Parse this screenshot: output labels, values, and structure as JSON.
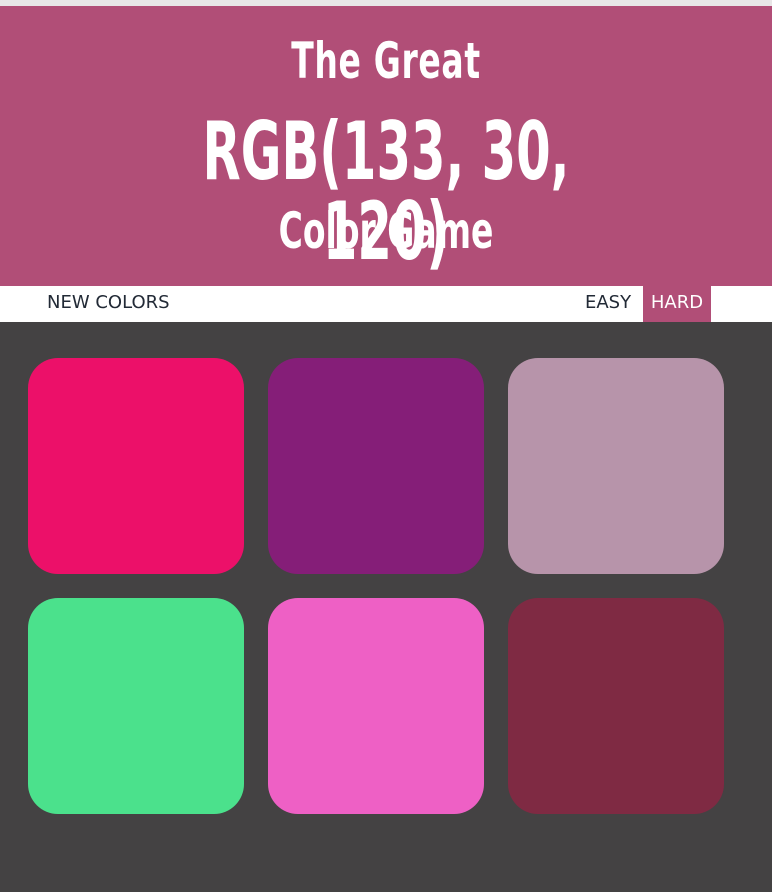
{
  "header": {
    "title_top": "The Great",
    "rgb_target": "RGB(133, 30, 120)",
    "title_bottom": "Color Game",
    "background": "#b14e77"
  },
  "controls": {
    "new_colors_label": "NEW COLORS",
    "message": "",
    "easy_label": "EASY",
    "hard_label": "HARD",
    "selected_mode": "HARD"
  },
  "board": {
    "background": "#444243",
    "squares": [
      {
        "color": "#ec1069"
      },
      {
        "color": "#851e78"
      },
      {
        "color": "#b794aa"
      },
      {
        "color": "#4be18c"
      },
      {
        "color": "#ee60c5"
      },
      {
        "color": "#7f2a43"
      }
    ]
  }
}
